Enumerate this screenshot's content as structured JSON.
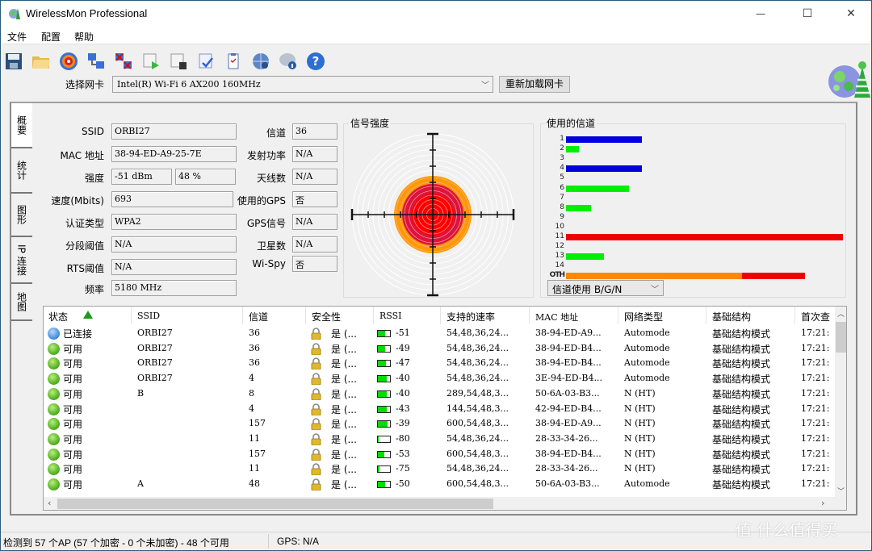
{
  "window": {
    "title": "WirelessMon Professional",
    "minimize_glyph": "—",
    "maximize_glyph": "☐",
    "close_glyph": "✕"
  },
  "menu": [
    "文件",
    "配置",
    "帮助"
  ],
  "toolbar": {
    "icons": [
      "save-icon",
      "open-folder-icon",
      "target-icon",
      "connect-icon",
      "disconnect-icon",
      "start-log-icon",
      "stop-log-icon",
      "report-icon",
      "clipboard-icon",
      "web-globe-icon",
      "info-chat-icon",
      "help-icon"
    ]
  },
  "nic": {
    "label": "选择网卡",
    "selected": "Intel(R) Wi-Fi 6 AX200 160MHz",
    "reload_label": "重新加载网卡"
  },
  "tabs": [
    "概要",
    "统计",
    "图形",
    "IP 连接",
    "地图"
  ],
  "summary": {
    "left": [
      {
        "label": "SSID",
        "value": "ORBI27"
      },
      {
        "label": "MAC 地址",
        "value": "38-94-ED-A9-25-7E"
      },
      {
        "label": "强度",
        "value": "-51  dBm",
        "value2": "48 %"
      },
      {
        "label": "速度(Mbits)",
        "value": "693"
      },
      {
        "label": "认证类型",
        "value": "WPA2"
      },
      {
        "label": "分段阈值",
        "value": "N/A"
      },
      {
        "label": "RTS阈值",
        "value": "N/A"
      },
      {
        "label": "频率",
        "value": "5180 MHz"
      }
    ],
    "right": [
      {
        "label": "信道",
        "value": "36"
      },
      {
        "label": "发射功率",
        "value": "N/A"
      },
      {
        "label": "天线数",
        "value": "N/A"
      },
      {
        "label": "使用的GPS",
        "value": "否"
      },
      {
        "label": "GPS信号",
        "value": "N/A"
      },
      {
        "label": "卫星数",
        "value": "N/A"
      },
      {
        "label": "Wi-Spy",
        "value": "否"
      }
    ]
  },
  "signal": {
    "title": "信号强度",
    "percent": 48
  },
  "channels": {
    "title": "使用的信道",
    "select_label": "信道使用  B/G/N",
    "colors": {
      "blue": "#0000dd",
      "green": "#00ee00",
      "red": "#ee0000",
      "orange": "#ff8800"
    }
  },
  "chart_data": {
    "type": "bar",
    "title": "使用的信道",
    "categories": [
      "1",
      "2",
      "3",
      "4",
      "5",
      "6",
      "7",
      "8",
      "9",
      "10",
      "11",
      "12",
      "13",
      "14",
      "OTH"
    ],
    "series": [
      {
        "name": "usage",
        "values": [
          6,
          1,
          0,
          6,
          0,
          5,
          0,
          2,
          0,
          0,
          22,
          0,
          3,
          0,
          19
        ]
      }
    ],
    "bar_colors": [
      "blue",
      "green",
      "",
      "blue",
      "",
      "green",
      "",
      "green",
      "",
      "",
      "red",
      "",
      "green",
      "",
      "orange+red"
    ],
    "oth_split": {
      "orange": 14,
      "red": 5
    },
    "orientation": "horizontal"
  },
  "table": {
    "columns": [
      "状态",
      "SSID",
      "信道",
      "安全性",
      "RSSI",
      "支持的速率",
      "MAC 地址",
      "网络类型",
      "基础结构",
      "首次查"
    ],
    "rows": [
      {
        "status": "已连接",
        "state": "blue",
        "ssid": "ORBI27",
        "channel": "36",
        "security": "是 (...",
        "rssi": "-51",
        "rates": "54,48,36,24...",
        "mac": "38-94-ED-A9...",
        "nettype": "Automode",
        "infra": "基础结构模式",
        "first": "17:21:"
      },
      {
        "status": "可用",
        "state": "green",
        "ssid": "ORBI27",
        "channel": "36",
        "security": "是 (...",
        "rssi": "-49",
        "rates": "54,48,36,24...",
        "mac": "38-94-ED-B4...",
        "nettype": "Automode",
        "infra": "基础结构模式",
        "first": "17:21:"
      },
      {
        "status": "可用",
        "state": "green",
        "ssid": "ORBI27",
        "channel": "36",
        "security": "是 (...",
        "rssi": "-47",
        "rates": "54,48,36,24...",
        "mac": "38-94-ED-B4...",
        "nettype": "Automode",
        "infra": "基础结构模式",
        "first": "17:21:"
      },
      {
        "status": "可用",
        "state": "green",
        "ssid": "ORBI27",
        "channel": "4",
        "security": "是 (...",
        "rssi": "-40",
        "rates": "54,48,36,24...",
        "mac": "3E-94-ED-B4...",
        "nettype": "Automode",
        "infra": "基础结构模式",
        "first": "17:21:"
      },
      {
        "status": "可用",
        "state": "green",
        "ssid": "B",
        "channel": "8",
        "security": "是 (...",
        "rssi": "-40",
        "rates": "289,54,48,3...",
        "mac": "50-6A-03-B3...",
        "nettype": "N (HT)",
        "infra": "基础结构模式",
        "first": "17:21:"
      },
      {
        "status": "可用",
        "state": "green",
        "ssid": "",
        "channel": "4",
        "security": "是 (...",
        "rssi": "-43",
        "rates": "144,54,48,3...",
        "mac": "42-94-ED-B4...",
        "nettype": "N (HT)",
        "infra": "基础结构模式",
        "first": "17:21:"
      },
      {
        "status": "可用",
        "state": "green",
        "ssid": "",
        "channel": "157",
        "security": "是 (...",
        "rssi": "-39",
        "rates": "600,54,48,3...",
        "mac": "38-94-ED-A9...",
        "nettype": "N (HT)",
        "infra": "基础结构模式",
        "first": "17:21:"
      },
      {
        "status": "可用",
        "state": "green",
        "ssid": "",
        "channel": "11",
        "security": "是 (...",
        "rssi": "-80",
        "rates": "54,48,36,24...",
        "mac": "28-33-34-26...",
        "nettype": "N (HT)",
        "infra": "基础结构模式",
        "first": "17:21:"
      },
      {
        "status": "可用",
        "state": "green",
        "ssid": "",
        "channel": "157",
        "security": "是 (...",
        "rssi": "-53",
        "rates": "600,54,48,3...",
        "mac": "38-94-ED-B4...",
        "nettype": "N (HT)",
        "infra": "基础结构模式",
        "first": "17:21:"
      },
      {
        "status": "可用",
        "state": "green",
        "ssid": "",
        "channel": "11",
        "security": "是 (...",
        "rssi": "-75",
        "rates": "54,48,36,24...",
        "mac": "28-33-34-26...",
        "nettype": "N (HT)",
        "infra": "基础结构模式",
        "first": "17:21:"
      },
      {
        "status": "可用",
        "state": "green",
        "ssid": "A",
        "channel": "48",
        "security": "是 (...",
        "rssi": "-50",
        "rates": "600,54,48,3...",
        "mac": "50-6A-03-B3...",
        "nettype": "Automode",
        "infra": "基础结构模式",
        "first": "17:21:"
      }
    ]
  },
  "status": {
    "summary": "检测到 57 个AP (57 个加密 - 0 个未加密) - 48 个可用",
    "gps": "GPS: N/A"
  },
  "watermark": "值 什么值得买"
}
